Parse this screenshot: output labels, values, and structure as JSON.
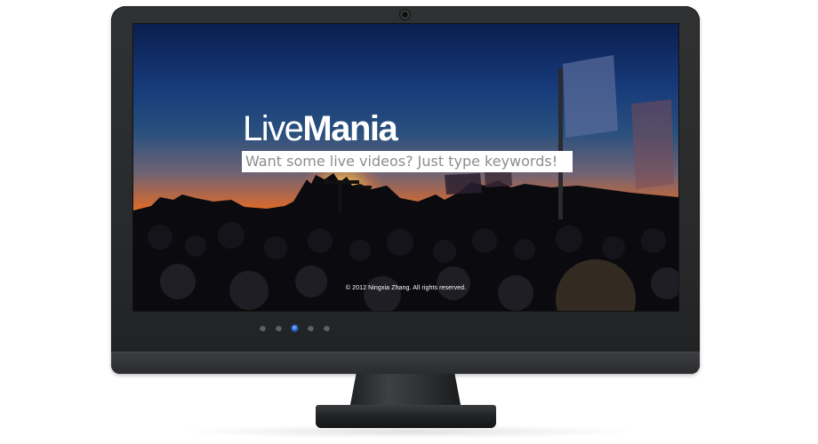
{
  "app": {
    "logo": {
      "part1": "Live",
      "part2": "Mania"
    },
    "search": {
      "placeholder": "Want some live videos? Just type keywords!"
    },
    "copyright": "© 2012 Ningxia Zhang. All rights reserved."
  },
  "carousel": {
    "count": 5,
    "active_index": 2
  },
  "colors": {
    "accent": "#2b6fe0",
    "monitor_bezel": "#2a2c2e",
    "text_placeholder": "#8d8d8d"
  }
}
